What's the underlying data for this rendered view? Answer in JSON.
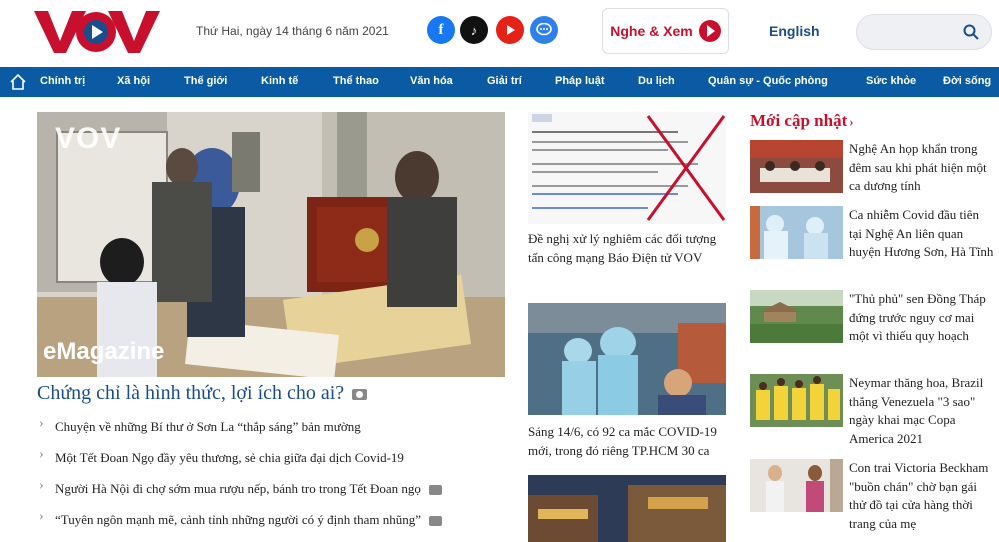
{
  "header": {
    "logo_text": "VOV",
    "date": "Thứ Hai, ngày 14 tháng 6 năm 2021",
    "listen_label": "Nghe & Xem",
    "english_label": "English",
    "search_placeholder": ""
  },
  "nav": {
    "items": [
      "Chính trị",
      "Xã hội",
      "Thế giới",
      "Kinh tế",
      "Thể thao",
      "Văn hóa",
      "Giải trí",
      "Pháp luật",
      "Du lịch",
      "Quân sự - Quốc phòng",
      "Sức khỏe",
      "Đời sống"
    ]
  },
  "hero": {
    "watermark": "VOV",
    "badge": "eMagazine",
    "title": "Chứng chỉ là hình thức, lợi ích cho ai?"
  },
  "related": [
    "Chuyện về những Bí thư ở Sơn La “thắp sáng” bản mường",
    "Một Tết Đoan Ngọ đầy yêu thương, sẻ chia giữa đại dịch Covid-19",
    "Người Hà Nội đi chợ sớm mua rượu nếp, bánh tro trong Tết Đoan ngọ",
    "“Tuyên ngôn mạnh mẽ, cảnh tỉnh những người có ý định tham nhũng”"
  ],
  "middle": [
    "Đề nghị xử lý nghiêm các đối tượng tấn công mạng Báo Điện tử VOV",
    "Sáng 14/6, có 92 ca mắc COVID-19 mới, trong đó riêng TP.HCM 30 ca"
  ],
  "latest": {
    "title": "Mới cập nhật",
    "items": [
      "Nghệ An họp khẩn trong đêm sau khi phát hiện một ca dương tính",
      "Ca nhiễm Covid đầu tiên tại Nghệ An liên quan huyện Hương Sơn, Hà Tĩnh",
      "\"Thủ phủ\" sen Đồng Tháp đứng trước nguy cơ mai một vì thiếu quy hoạch",
      "Neymar thăng hoa, Brazil thắng Venezuela \"3 sao\" ngày khai mạc Copa America 2021",
      "Con trai Victoria Beckham \"buồn chán\" chờ bạn gái thử đồ tại cửa hàng thời trang của mẹ"
    ]
  },
  "colors": {
    "brand_red": "#c8102e",
    "nav_blue": "#0a5aa4",
    "link_blue": "#1a4d8c"
  }
}
